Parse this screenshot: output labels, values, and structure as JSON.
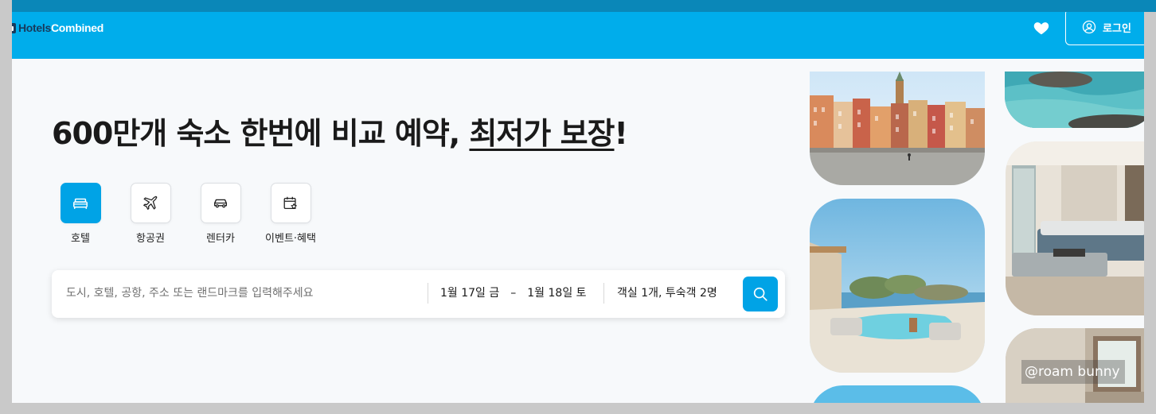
{
  "header": {
    "logo_part1": "Hotels",
    "logo_part2": "Combined",
    "login_label": "로그인"
  },
  "hero": {
    "title_prefix": "600만개 숙소 한번에 비교 예약, ",
    "title_underlined": "최저가 보장",
    "title_suffix": "!"
  },
  "categories": [
    {
      "label": "호텔",
      "icon": "bed-icon",
      "active": true
    },
    {
      "label": "항공권",
      "icon": "airplane-icon",
      "active": false
    },
    {
      "label": "렌터카",
      "icon": "car-icon",
      "active": false
    },
    {
      "label": "이벤트·혜택",
      "icon": "calendar-star-icon",
      "active": false
    }
  ],
  "search": {
    "destination_placeholder": "도시, 호텔, 공항, 주소 또는 랜드마크를 입력해주세요",
    "checkin": "1월 17일 금",
    "date_separator": "–",
    "checkout": "1월 18일 토",
    "guests": "객실 1개, 투숙객 2명"
  },
  "watermark": "@roam bunny",
  "colors": {
    "brand": "#00adeb",
    "accent": "#00a3e6",
    "logo_dark": "#173a5c"
  }
}
